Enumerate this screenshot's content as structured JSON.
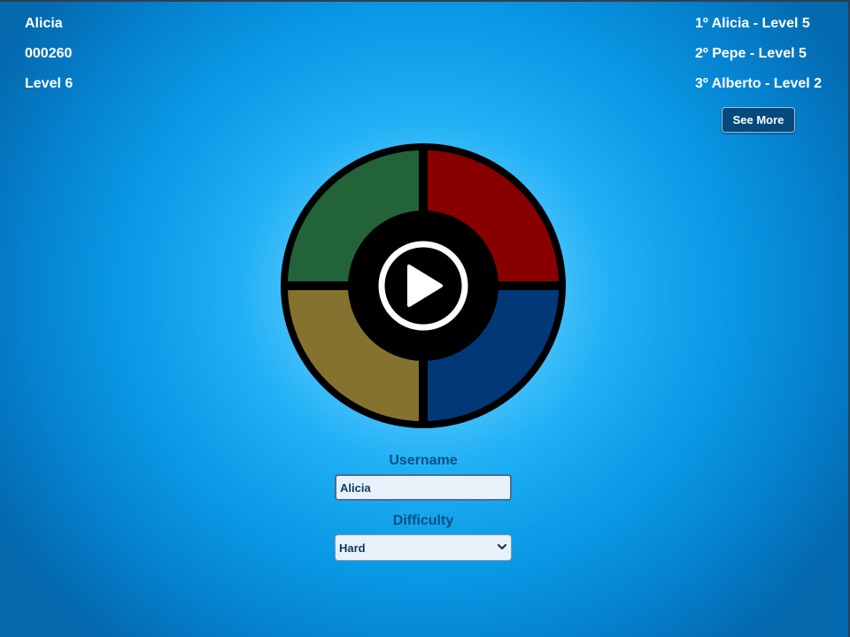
{
  "player": {
    "name": "Alicia",
    "score": "000260",
    "level": "Level 6"
  },
  "leaderboard": {
    "ranks": [
      "1º Alicia - Level 5",
      "2º Pepe - Level 5",
      "3º Alberto - Level 2"
    ],
    "see_more_label": "See More"
  },
  "game_board": {
    "pads": [
      {
        "name": "green-pad",
        "color": "#236339"
      },
      {
        "name": "red-pad",
        "color": "#880000"
      },
      {
        "name": "yellow-pad",
        "color": "#84722f"
      },
      {
        "name": "blue-pad",
        "color": "#013878"
      }
    ],
    "center_color": "#000000",
    "play_icon": "play-circle-icon"
  },
  "form": {
    "username_label": "Username",
    "username_value": "Alicia",
    "difficulty_label": "Difficulty",
    "difficulty_selected": "Hard",
    "difficulty_icon": "chevron-down-icon"
  }
}
